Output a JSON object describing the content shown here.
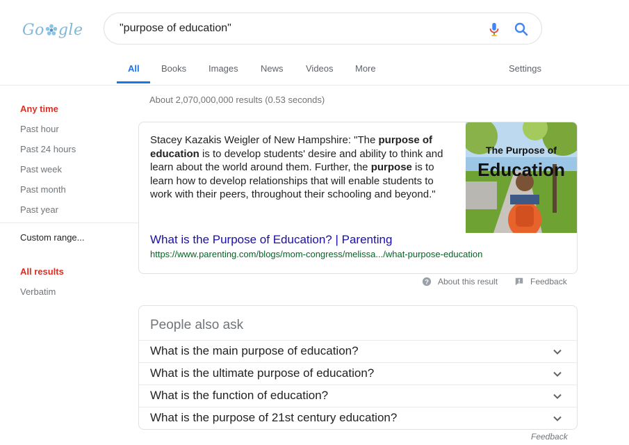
{
  "logo": {
    "text_left": "Go",
    "text_right": "gle"
  },
  "search": {
    "query": "\"purpose of education\""
  },
  "tabs": [
    {
      "label": "All"
    },
    {
      "label": "Books"
    },
    {
      "label": "Images"
    },
    {
      "label": "News"
    },
    {
      "label": "Videos"
    },
    {
      "label": "More"
    }
  ],
  "settings_label": "Settings",
  "sidebar": {
    "any_time": "Any time",
    "items": [
      "Past hour",
      "Past 24 hours",
      "Past week",
      "Past month",
      "Past year"
    ],
    "custom_range": "Custom range...",
    "all_results": "All results",
    "verbatim": "Verbatim"
  },
  "stats": "About 2,070,000,000 results (0.53 seconds)",
  "snippet": {
    "t1": "Stacey Kazakis Weigler of New Hampshire: \"The ",
    "b1": "purpose of education",
    "t2": " is to develop students' desire and ability to think and learn about the world around them. Further, the ",
    "b2": "purpose",
    "t3": " is to learn how to develop relationships that will enable students to work with their peers, throughout their schooling and beyond.\"",
    "image_title_1": "The Purpose of",
    "image_title_2": "Education",
    "link": "What is the Purpose of Education? | Parenting",
    "url": "https://www.parenting.com/blogs/mom-congress/melissa.../what-purpose-education",
    "about": "About this result",
    "feedback": "Feedback"
  },
  "paa": {
    "title": "People also ask",
    "questions": [
      "What is the main purpose of education?",
      "What is the ultimate purpose of education?",
      "What is the function of education?",
      "What is the purpose of 21st century education?"
    ],
    "feedback": "Feedback"
  },
  "colors": {
    "accent": "#1a73e8",
    "link": "#1a0dab",
    "url": "#006621",
    "sidebar_active": "#d93025"
  }
}
